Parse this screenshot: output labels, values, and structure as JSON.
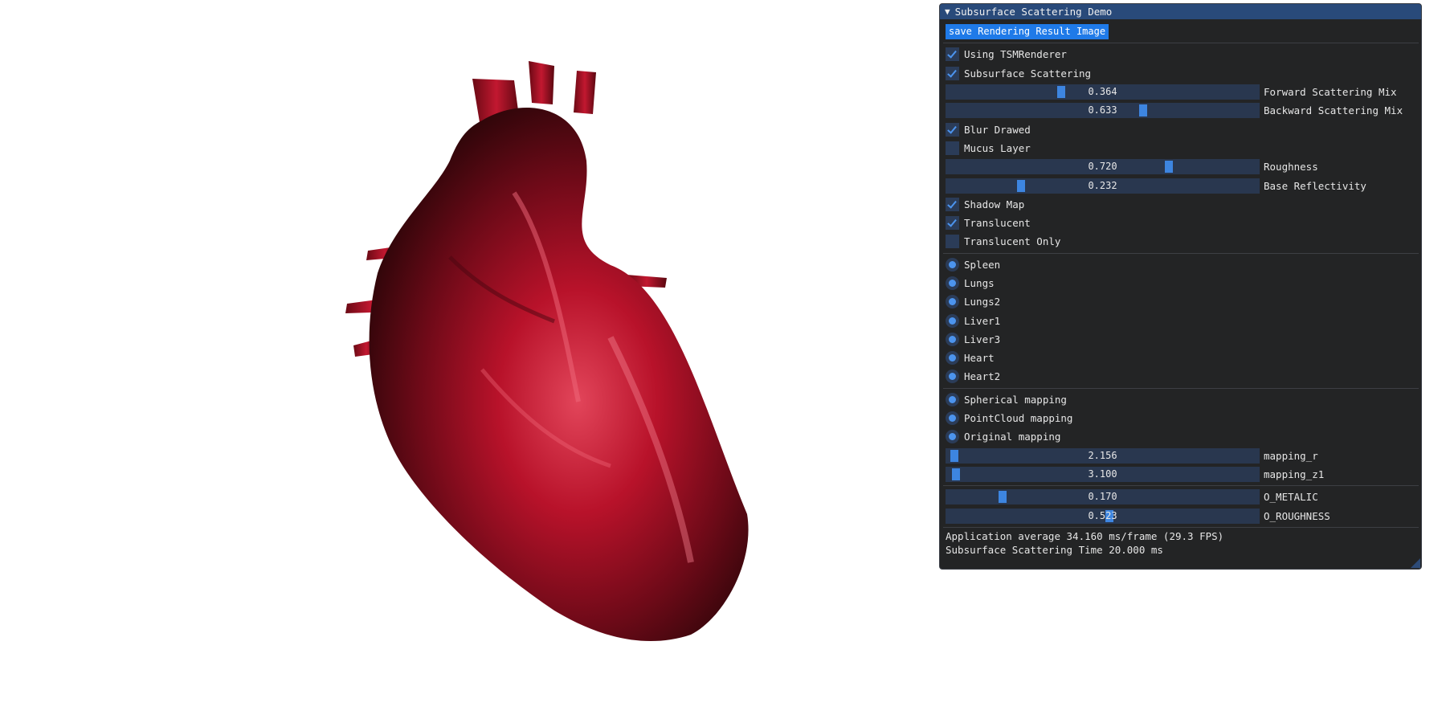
{
  "panel": {
    "title": "Subsurface Scattering Demo",
    "save_button": "save Rendering Result Image",
    "checks_a": [
      {
        "label": "Using TSMRenderer",
        "checked": true
      },
      {
        "label": "Subsurface Scattering",
        "checked": true
      }
    ],
    "sliders_a": [
      {
        "value": "0.364",
        "label": "Forward Scattering Mix",
        "fraction": 0.364
      },
      {
        "value": "0.633",
        "label": "Backward Scattering Mix",
        "fraction": 0.633
      }
    ],
    "checks_b": [
      {
        "label": "Blur Drawed",
        "checked": true
      },
      {
        "label": "Mucus Layer",
        "checked": false
      }
    ],
    "sliders_b": [
      {
        "value": "0.720",
        "label": "Roughness",
        "fraction": 0.72
      },
      {
        "value": "0.232",
        "label": "Base Reflectivity",
        "fraction": 0.232
      }
    ],
    "checks_c": [
      {
        "label": "Shadow Map",
        "checked": true
      },
      {
        "label": "Translucent",
        "checked": true
      },
      {
        "label": "Translucent Only",
        "checked": false
      }
    ],
    "models": [
      "Spleen",
      "Lungs",
      "Lungs2",
      "Liver1",
      "Liver3",
      "Heart",
      "Heart2"
    ],
    "mappings": [
      "Spherical mapping",
      "PointCloud mapping",
      "Original mapping"
    ],
    "mapping_sliders": [
      {
        "value": "2.156",
        "label": "mapping_r",
        "fraction": 0.01
      },
      {
        "value": "3.100",
        "label": "mapping_z1",
        "fraction": 0.015
      }
    ],
    "material_sliders": [
      {
        "value": "0.170",
        "label": "O_METALIC",
        "fraction": 0.17
      },
      {
        "value": "0.523",
        "label": "O_ROUGHNESS",
        "fraction": 0.523
      }
    ],
    "stats": {
      "app_average": "Application average 34.160 ms/frame (29.3 FPS)",
      "sss_time": "Subsurface Scattering Time 20.000 ms"
    }
  },
  "colors": {
    "panel_bg": "#151617",
    "title_bg": "#294a7a",
    "accent": "#4c94ee",
    "button": "#1f7ae8",
    "heart_red": "#c8102e"
  }
}
